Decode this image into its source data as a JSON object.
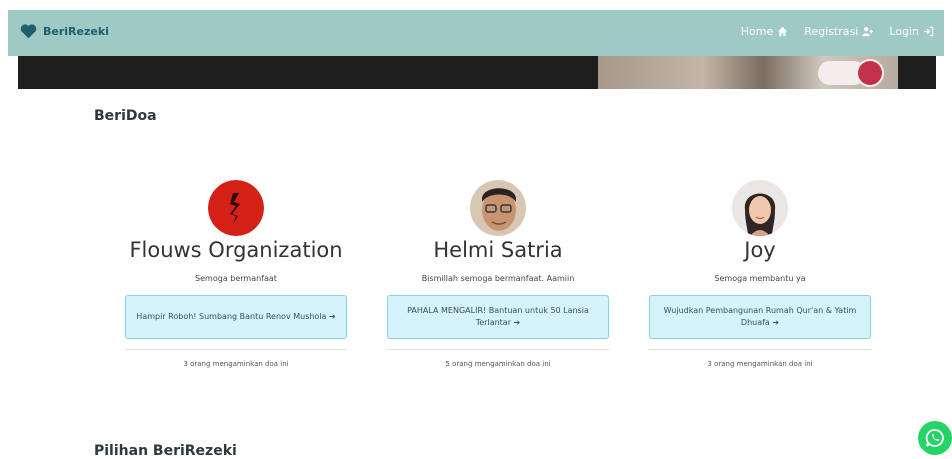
{
  "navbar": {
    "brand": "BeriRezeki",
    "links": [
      {
        "label": "Home",
        "icon": "home-icon"
      },
      {
        "label": "Registrasi",
        "icon": "user-plus-icon"
      },
      {
        "label": "Login",
        "icon": "sign-in-icon"
      }
    ]
  },
  "sections": {
    "beridoa_title": "BeriDoa",
    "pilihan_title": "Pilihan BeriRezeki"
  },
  "prayers": [
    {
      "name": "Flouws Organization",
      "message": "Semoga bermanfaat",
      "campaign": "Hampir Roboh! Sumbang Bantu Renov Mushola ➔",
      "count": "3 orang mengaminkan doa ini",
      "avatar": "organization-logo"
    },
    {
      "name": "Helmi Satria",
      "message": "Bismillah semoga bermanfaat. Aamiin",
      "campaign": "PAHALA MENGALIR! Bantuan untuk 50 Lansia Terlantar ➔",
      "count": "5 orang mengaminkan doa ini",
      "avatar": "user-photo"
    },
    {
      "name": "Joy",
      "message": "Semoga membantu ya",
      "campaign": "Wujudkan Pembangunan Rumah Qur'an & Yatim Dhuafa ➔",
      "count": "3 orang mengaminkan doa ini",
      "avatar": "user-photo"
    }
  ],
  "colors": {
    "navbar": "#9ec9c5",
    "accent": "#1d5f6a",
    "campaign_bg": "#d6f2fa",
    "whatsapp": "#25d366"
  }
}
